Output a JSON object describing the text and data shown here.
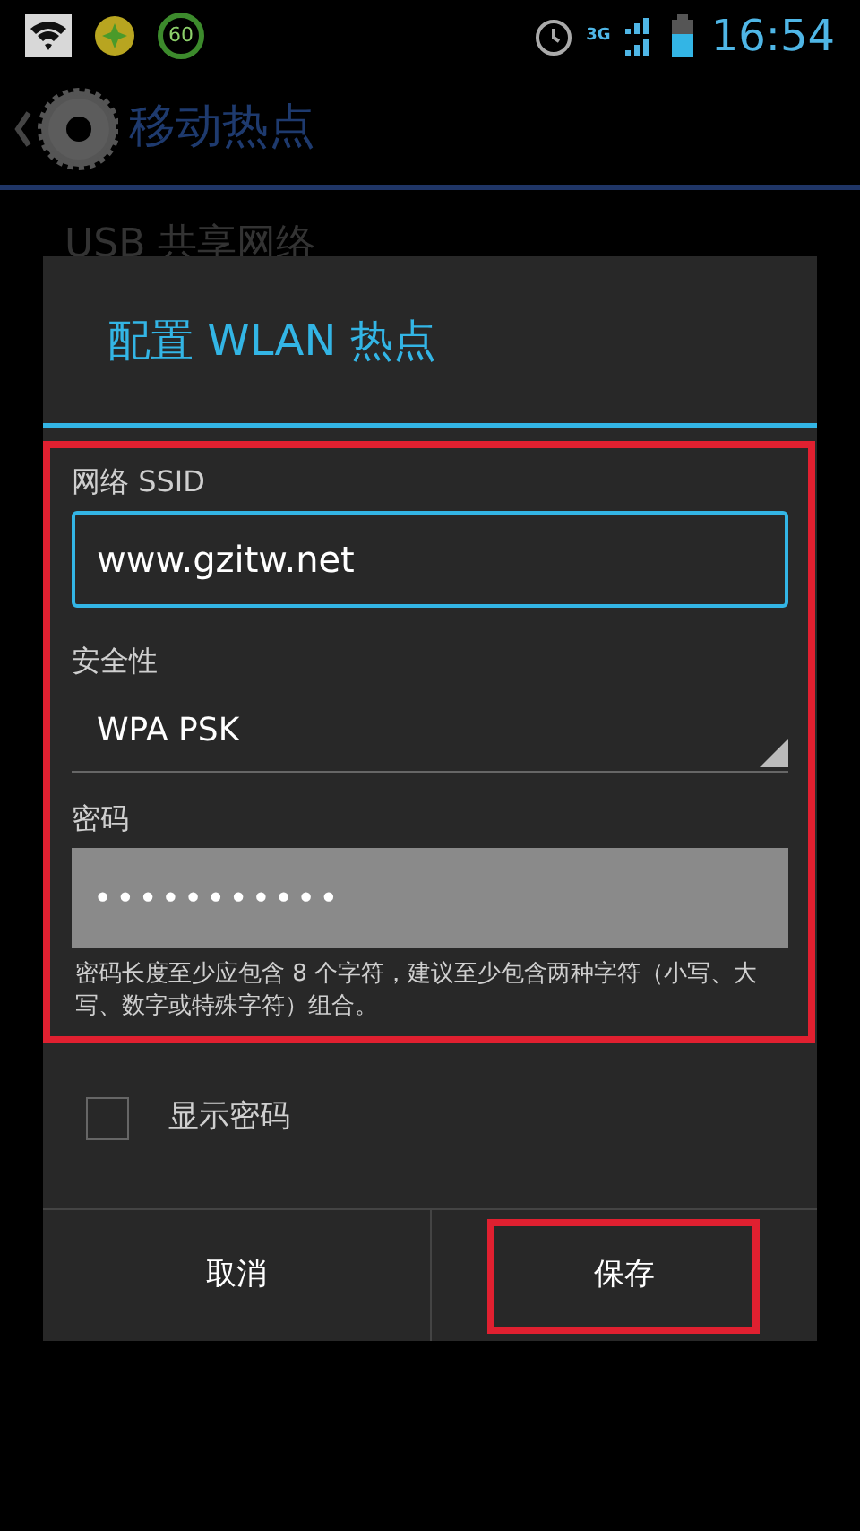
{
  "status_bar": {
    "badge": "60",
    "network": "3G",
    "time": "16:54"
  },
  "action_bar": {
    "title": "移动热点"
  },
  "background_items": [
    {
      "label": "USB 共享网络"
    }
  ],
  "dialog": {
    "title": "配置 WLAN 热点",
    "fields": [
      {
        "kind": "text",
        "label": "网络 SSID",
        "value": "www.gzitw.net",
        "focused": true
      },
      {
        "kind": "select",
        "label": "安全性",
        "value": "WPA PSK"
      },
      {
        "kind": "password",
        "label": "密码",
        "value": "•••••••••••"
      }
    ],
    "hint": "密码长度至少应包含 8 个字符，建议至少包含两种字符（小写、大写、数字或特殊字符）组合。",
    "show_password": {
      "label": "显示密码",
      "checked": false
    },
    "buttons": [
      {
        "label": "取消",
        "highlighted": false
      },
      {
        "label": "保存",
        "highlighted": true
      }
    ]
  }
}
